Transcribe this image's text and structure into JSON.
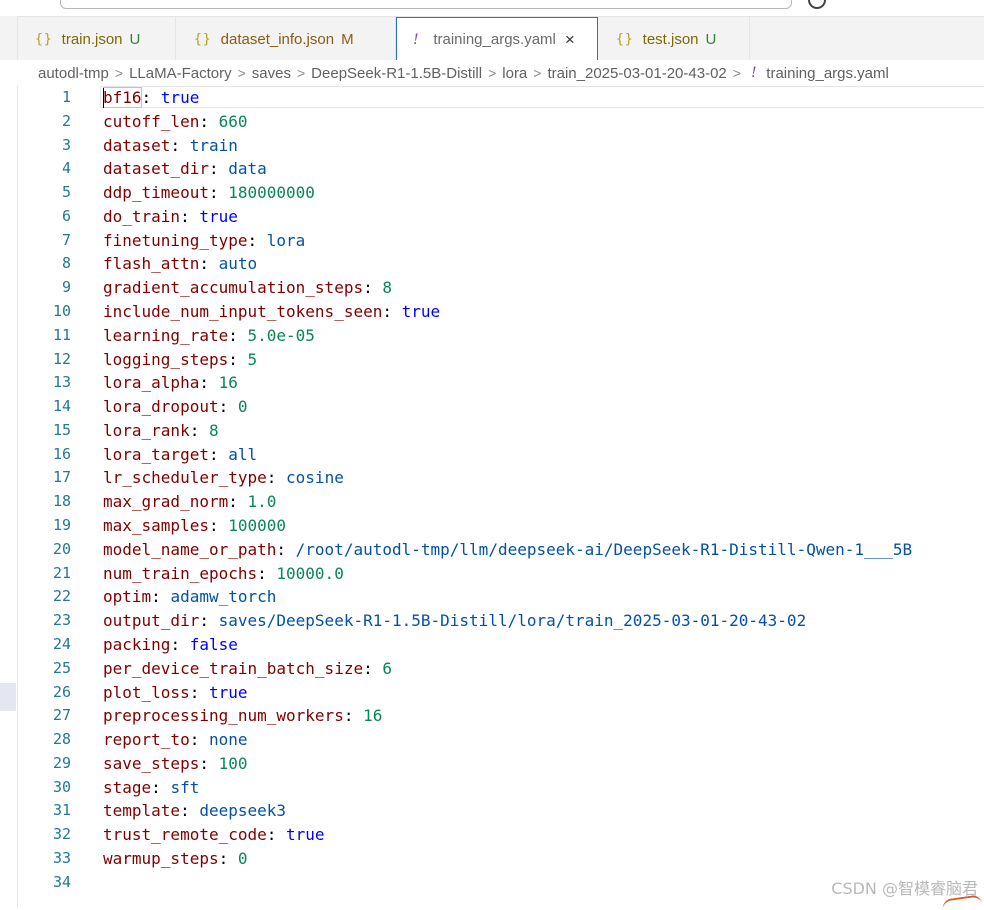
{
  "tabs": [
    {
      "icon": "{}",
      "name": "train.json",
      "badge": "U",
      "modified": false,
      "active": false
    },
    {
      "icon": "{}",
      "name": "dataset_info.json",
      "badge": "M",
      "modified": true,
      "active": false
    },
    {
      "icon": "!",
      "name": "training_args.yaml",
      "badge": "",
      "modified": false,
      "active": true,
      "close": "×"
    },
    {
      "icon": "{}",
      "name": "test.json",
      "badge": "U",
      "modified": false,
      "active": false
    }
  ],
  "breadcrumb": {
    "parts": [
      "autodl-tmp",
      "LLaMA-Factory",
      "saves",
      "DeepSeek-R1-1.5B-Distill",
      "lora",
      "train_2025-03-01-20-43-02"
    ],
    "separator": ">",
    "file_icon": "!",
    "file": "training_args.yaml"
  },
  "editor": {
    "lines": [
      {
        "n": "1",
        "key": "bf16",
        "value": "true",
        "kind": "bool"
      },
      {
        "n": "2",
        "key": "cutoff_len",
        "value": "660",
        "kind": "num"
      },
      {
        "n": "3",
        "key": "dataset",
        "value": "train",
        "kind": "str"
      },
      {
        "n": "4",
        "key": "dataset_dir",
        "value": "data",
        "kind": "str"
      },
      {
        "n": "5",
        "key": "ddp_timeout",
        "value": "180000000",
        "kind": "num"
      },
      {
        "n": "6",
        "key": "do_train",
        "value": "true",
        "kind": "bool"
      },
      {
        "n": "7",
        "key": "finetuning_type",
        "value": "lora",
        "kind": "str"
      },
      {
        "n": "8",
        "key": "flash_attn",
        "value": "auto",
        "kind": "str"
      },
      {
        "n": "9",
        "key": "gradient_accumulation_steps",
        "value": "8",
        "kind": "num"
      },
      {
        "n": "10",
        "key": "include_num_input_tokens_seen",
        "value": "true",
        "kind": "bool"
      },
      {
        "n": "11",
        "key": "learning_rate",
        "value": "5.0e-05",
        "kind": "num"
      },
      {
        "n": "12",
        "key": "logging_steps",
        "value": "5",
        "kind": "num"
      },
      {
        "n": "13",
        "key": "lora_alpha",
        "value": "16",
        "kind": "num"
      },
      {
        "n": "14",
        "key": "lora_dropout",
        "value": "0",
        "kind": "num"
      },
      {
        "n": "15",
        "key": "lora_rank",
        "value": "8",
        "kind": "num"
      },
      {
        "n": "16",
        "key": "lora_target",
        "value": "all",
        "kind": "str"
      },
      {
        "n": "17",
        "key": "lr_scheduler_type",
        "value": "cosine",
        "kind": "str"
      },
      {
        "n": "18",
        "key": "max_grad_norm",
        "value": "1.0",
        "kind": "num"
      },
      {
        "n": "19",
        "key": "max_samples",
        "value": "100000",
        "kind": "num"
      },
      {
        "n": "20",
        "key": "model_name_or_path",
        "value": "/root/autodl-tmp/llm/deepseek-ai/DeepSeek-R1-Distill-Qwen-1___5B",
        "kind": "str"
      },
      {
        "n": "21",
        "key": "num_train_epochs",
        "value": "10000.0",
        "kind": "num"
      },
      {
        "n": "22",
        "key": "optim",
        "value": "adamw_torch",
        "kind": "str"
      },
      {
        "n": "23",
        "key": "output_dir",
        "value": "saves/DeepSeek-R1-1.5B-Distill/lora/train_2025-03-01-20-43-02",
        "kind": "str"
      },
      {
        "n": "24",
        "key": "packing",
        "value": "false",
        "kind": "bool"
      },
      {
        "n": "25",
        "key": "per_device_train_batch_size",
        "value": "6",
        "kind": "num"
      },
      {
        "n": "26",
        "key": "plot_loss",
        "value": "true",
        "kind": "bool"
      },
      {
        "n": "27",
        "key": "preprocessing_num_workers",
        "value": "16",
        "kind": "num"
      },
      {
        "n": "28",
        "key": "report_to",
        "value": "none",
        "kind": "str"
      },
      {
        "n": "29",
        "key": "save_steps",
        "value": "100",
        "kind": "num"
      },
      {
        "n": "30",
        "key": "stage",
        "value": "sft",
        "kind": "str"
      },
      {
        "n": "31",
        "key": "template",
        "value": "deepseek3",
        "kind": "str"
      },
      {
        "n": "32",
        "key": "trust_remote_code",
        "value": "true",
        "kind": "bool"
      },
      {
        "n": "33",
        "key": "warmup_steps",
        "value": "0",
        "kind": "num"
      },
      {
        "n": "34",
        "key": "",
        "value": "",
        "kind": "empty"
      }
    ]
  },
  "watermark": "CSDN @智模睿脑君",
  "colors": {
    "key": "#800000",
    "string": "#0451a5",
    "number": "#098658",
    "boolean": "#0000ff",
    "line_number": "#237893",
    "active_tab_border": "#2a6fd6"
  }
}
